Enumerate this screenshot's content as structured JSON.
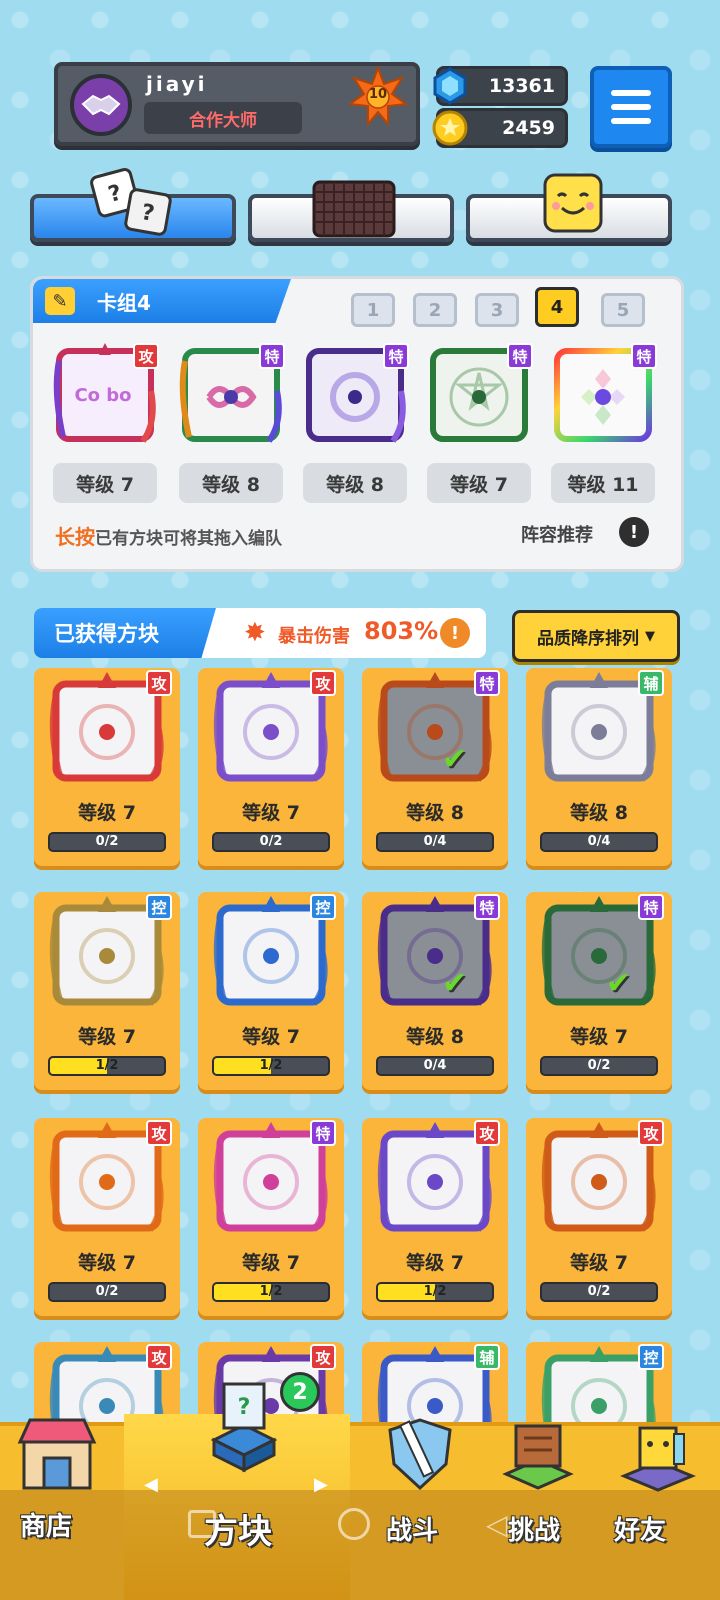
{
  "header": {
    "username": "jiayi",
    "title": "合作大师",
    "level": "10",
    "gems": "13361",
    "coins": "2459"
  },
  "deck": {
    "title": "卡组4",
    "decks": [
      "1",
      "2",
      "3",
      "4",
      "5"
    ],
    "active_deck_index": 3,
    "cards": [
      {
        "badge": "攻",
        "level": "等级 7",
        "logo": "Co bo"
      },
      {
        "badge": "特",
        "level": "等级 8"
      },
      {
        "badge": "特",
        "level": "等级 8"
      },
      {
        "badge": "特",
        "level": "等级 7"
      },
      {
        "badge": "特",
        "level": "等级 11"
      }
    ],
    "hint_highlight": "长按",
    "hint_text": "已有方块可将其拖入编队",
    "recommend_label": "阵容推荐"
  },
  "obtained": {
    "title": "已获得方块",
    "crit_label": "暴击伤害",
    "crit_value": "803%",
    "sort_label": "品质降序排列"
  },
  "cards": [
    {
      "badge": "攻",
      "level": "等级 7",
      "progress": "0/2",
      "fill": 0,
      "color": "#d83a3a",
      "owned": false
    },
    {
      "badge": "攻",
      "level": "等级 7",
      "progress": "0/2",
      "fill": 0,
      "color": "#7b4fc9",
      "owned": false
    },
    {
      "badge": "特",
      "level": "等级 8",
      "progress": "0/4",
      "fill": 0,
      "color": "#b84a1c",
      "owned": true
    },
    {
      "badge": "辅",
      "level": "等级 8",
      "progress": "0/4",
      "fill": 0,
      "color": "#7c7e99",
      "owned": false
    },
    {
      "badge": "控",
      "level": "等级 7",
      "progress": "1/2",
      "fill": 0.5,
      "color": "#a88a3a",
      "owned": false
    },
    {
      "badge": "控",
      "level": "等级 7",
      "progress": "1/2",
      "fill": 0.5,
      "color": "#2d6ad0",
      "owned": false
    },
    {
      "badge": "特",
      "level": "等级 8",
      "progress": "0/4",
      "fill": 0,
      "color": "#4a2d8a",
      "owned": true
    },
    {
      "badge": "特",
      "level": "等级 7",
      "progress": "0/2",
      "fill": 0,
      "color": "#2a6a3a",
      "owned": true
    },
    {
      "badge": "攻",
      "level": "等级 7",
      "progress": "0/2",
      "fill": 0,
      "color": "#e06a18",
      "owned": false
    },
    {
      "badge": "特",
      "level": "等级 7",
      "progress": "1/2",
      "fill": 0.5,
      "color": "#d0409a",
      "owned": false
    },
    {
      "badge": "攻",
      "level": "等级 7",
      "progress": "1/2",
      "fill": 0.5,
      "color": "#6a48c8",
      "owned": false
    },
    {
      "badge": "攻",
      "level": "等级 7",
      "progress": "0/2",
      "fill": 0,
      "color": "#d05a18",
      "owned": false
    },
    {
      "badge": "攻",
      "level": "",
      "progress": "",
      "fill": 0,
      "color": "#3a8ab8",
      "owned": false
    },
    {
      "badge": "攻",
      "level": "",
      "progress": "",
      "fill": 0,
      "color": "#6a3aa8",
      "owned": false
    },
    {
      "badge": "辅",
      "level": "",
      "progress": "",
      "fill": 0,
      "color": "#3a5ac8",
      "owned": false
    },
    {
      "badge": "控",
      "level": "",
      "progress": "",
      "fill": 0,
      "color": "#3aa068",
      "owned": false
    }
  ],
  "badge_colors": {
    "攻": "#e23a3a",
    "特": "#8a3ad6",
    "辅": "#3ab86a",
    "控": "#2a86e0"
  },
  "nav": {
    "shop": "商店",
    "blocks": "方块",
    "battle": "战斗",
    "challenge": "挑战",
    "friends": "好友",
    "blocks_badge": "2"
  }
}
